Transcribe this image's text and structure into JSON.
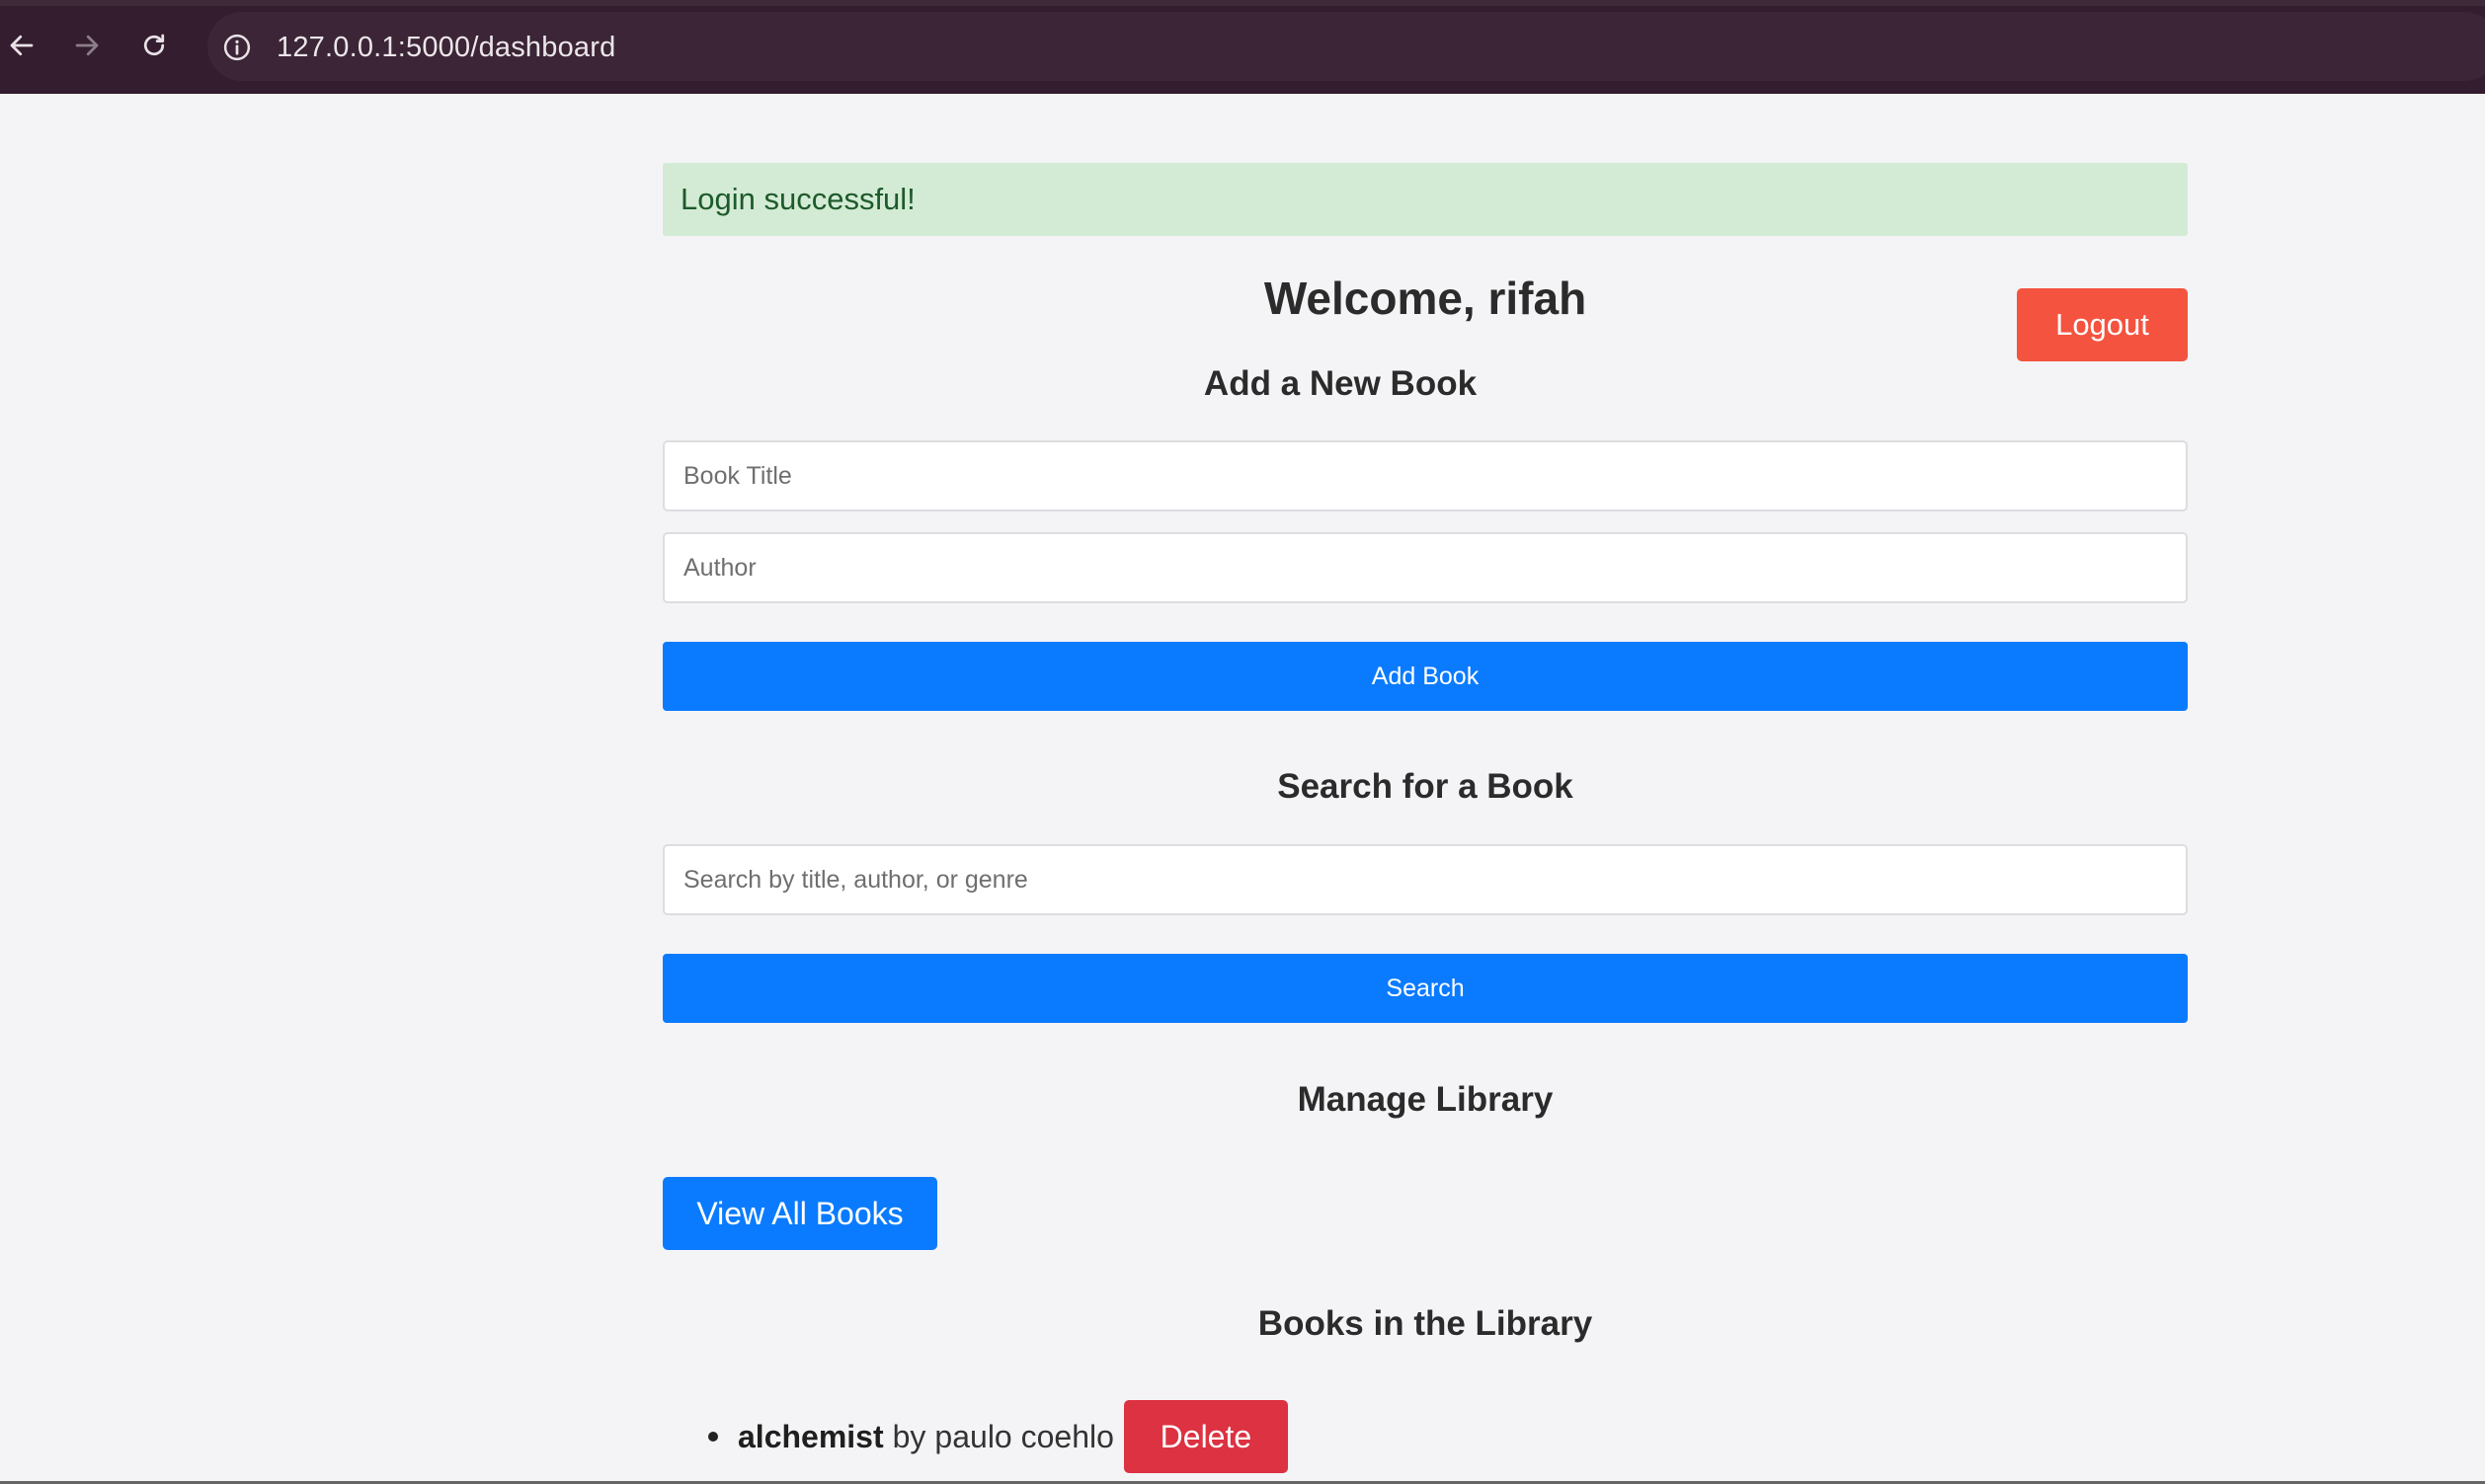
{
  "browser": {
    "url": "127.0.0.1:5000/dashboard",
    "back_icon": "arrow-left-icon",
    "forward_icon": "arrow-right-icon",
    "reload_icon": "reload-icon",
    "site_info_icon": "info-circle-icon"
  },
  "alert": {
    "message": "Login successful!"
  },
  "header": {
    "welcome": "Welcome, rifah",
    "logout_label": "Logout"
  },
  "add_book": {
    "heading": "Add a New Book",
    "title_placeholder": "Book Title",
    "title_value": "",
    "author_placeholder": "Author",
    "author_value": "",
    "button_label": "Add Book"
  },
  "search": {
    "heading": "Search for a Book",
    "placeholder": "Search by title, author, or genre",
    "value": "",
    "button_label": "Search"
  },
  "manage": {
    "heading": "Manage Library",
    "view_all_label": "View All Books"
  },
  "library": {
    "heading": "Books in the Library",
    "books": [
      {
        "title": "alchemist",
        "by": "by",
        "author": "paulo coehlo",
        "delete_label": "Delete"
      }
    ]
  },
  "colors": {
    "browser_bar": "#331d2e",
    "alert_bg": "#d3ebd5",
    "alert_text": "#1d5a2a",
    "primary": "#0a7bff",
    "logout": "#f4533f",
    "delete": "#dc3241",
    "page_bg": "#f4f4f7"
  }
}
